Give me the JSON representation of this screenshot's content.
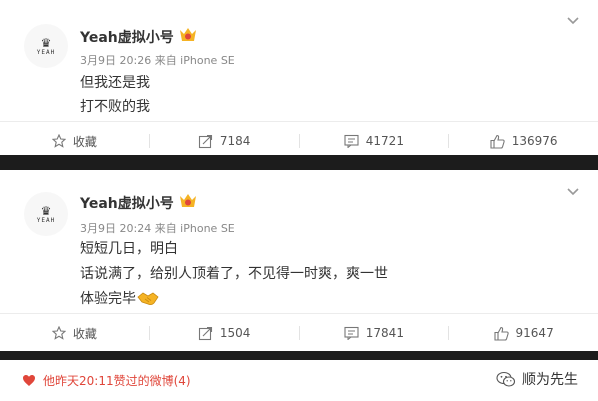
{
  "posts": [
    {
      "username": "Yeah虚拟小号",
      "meta": "3月9日 20:26 来自 iPhone SE",
      "lines": [
        "但我还是我",
        "打不败的我"
      ],
      "actions": {
        "favorite": "收藏",
        "repost": "7184",
        "comment": "41721",
        "like": "136976"
      }
    },
    {
      "username": "Yeah虚拟小号",
      "meta": "3月9日 20:24 来自 iPhone SE",
      "lines": [
        "短短几日，明白",
        "话说满了，给别人顶着了，不见得一时爽，爽一世",
        "体验完毕"
      ],
      "actions": {
        "favorite": "收藏",
        "repost": "1504",
        "comment": "17841",
        "like": "91647"
      }
    }
  ],
  "avatar_text": "YEAH",
  "footer": {
    "liked_text": "他昨天20:11赞过的微博(4)",
    "brand": "顺为先生"
  },
  "colors": {
    "accent": "#e0463a",
    "text": "#333333",
    "meta": "#888888"
  },
  "icons": [
    "crown-icon",
    "vip-icon",
    "chevron-down-icon",
    "star-icon",
    "repost-icon",
    "comment-icon",
    "thumb-up-icon",
    "handshake-emoji",
    "heart-icon",
    "wechat-icon"
  ]
}
